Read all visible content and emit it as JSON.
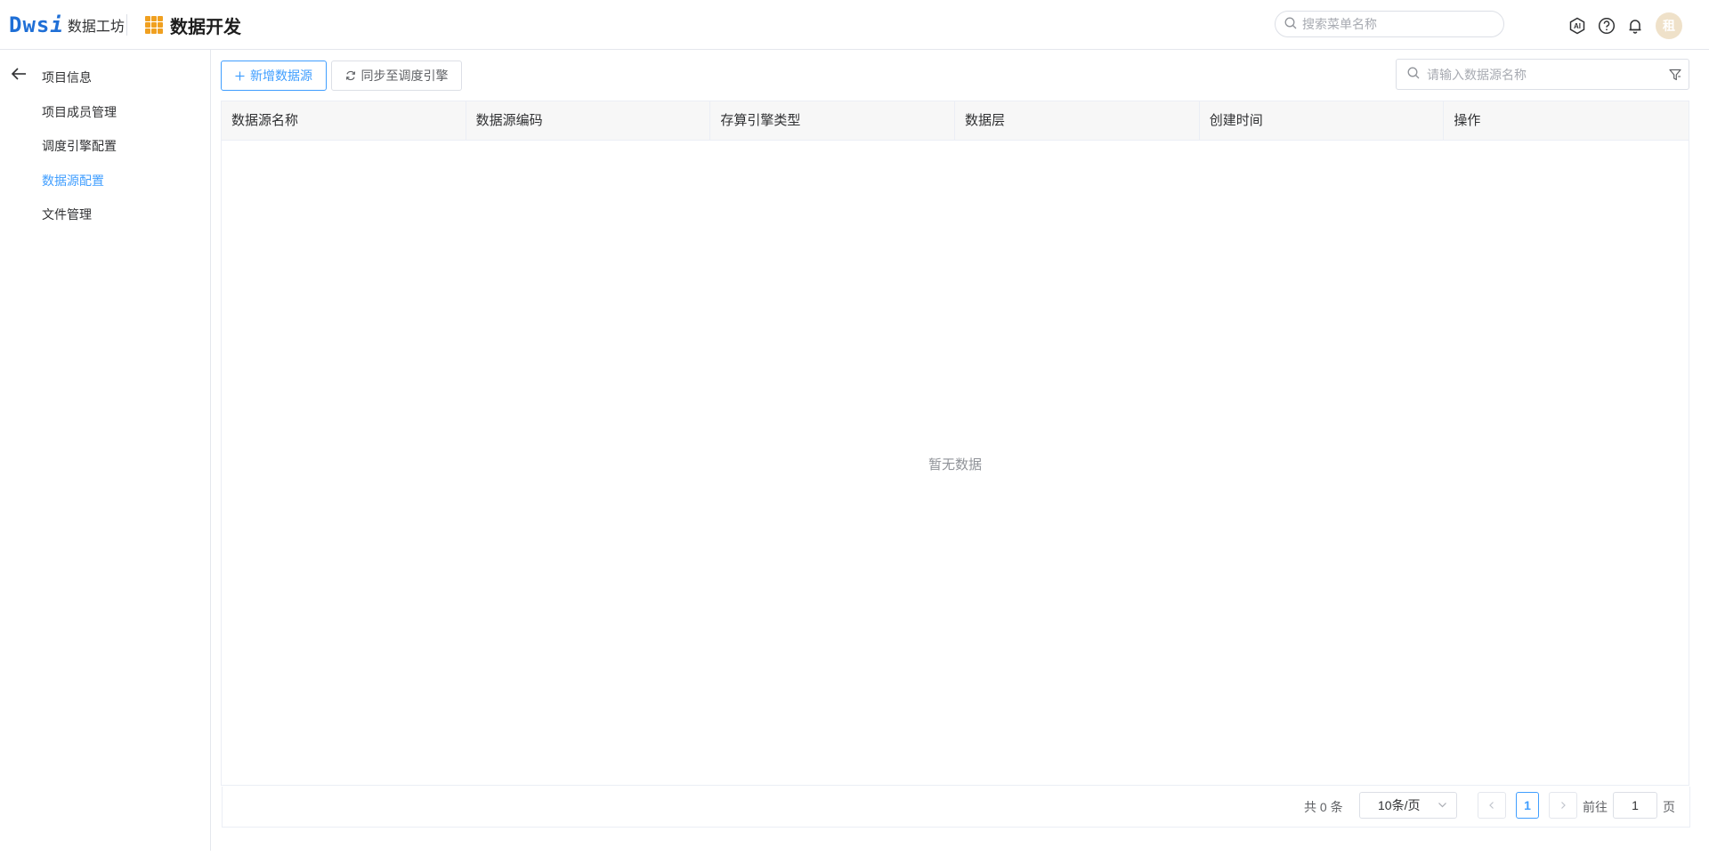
{
  "header": {
    "logo_mark": "Dws",
    "logo_mark_i": "i",
    "logo_sub": "数据工坊",
    "app_title": "数据开发",
    "menu_search_placeholder": "搜索菜单名称",
    "avatar_text": "租",
    "icons": [
      "ai-icon",
      "help-icon",
      "bell-icon"
    ]
  },
  "sidebar": {
    "items": [
      {
        "label": "项目信息",
        "active": false
      },
      {
        "label": "项目成员管理",
        "active": false
      },
      {
        "label": "调度引擎配置",
        "active": false
      },
      {
        "label": "数据源配置",
        "active": true
      },
      {
        "label": "文件管理",
        "active": false
      }
    ]
  },
  "toolbar": {
    "add_label": "新增数据源",
    "sync_label": "同步至调度引擎",
    "search_placeholder": "请输入数据源名称"
  },
  "table": {
    "columns": [
      "数据源名称",
      "数据源编码",
      "存算引擎类型",
      "数据层",
      "创建时间",
      "操作"
    ],
    "rows": [],
    "empty_text": "暂无数据"
  },
  "pagination": {
    "total_label": "共 0 条",
    "page_size": "10条/页",
    "current_page": "1",
    "goto_label": "前往",
    "goto_value": "1",
    "page_suffix": "页"
  },
  "colors": {
    "accent": "#409eff",
    "logo": "#1f6fd6",
    "grid_icon": "#f0a020"
  }
}
